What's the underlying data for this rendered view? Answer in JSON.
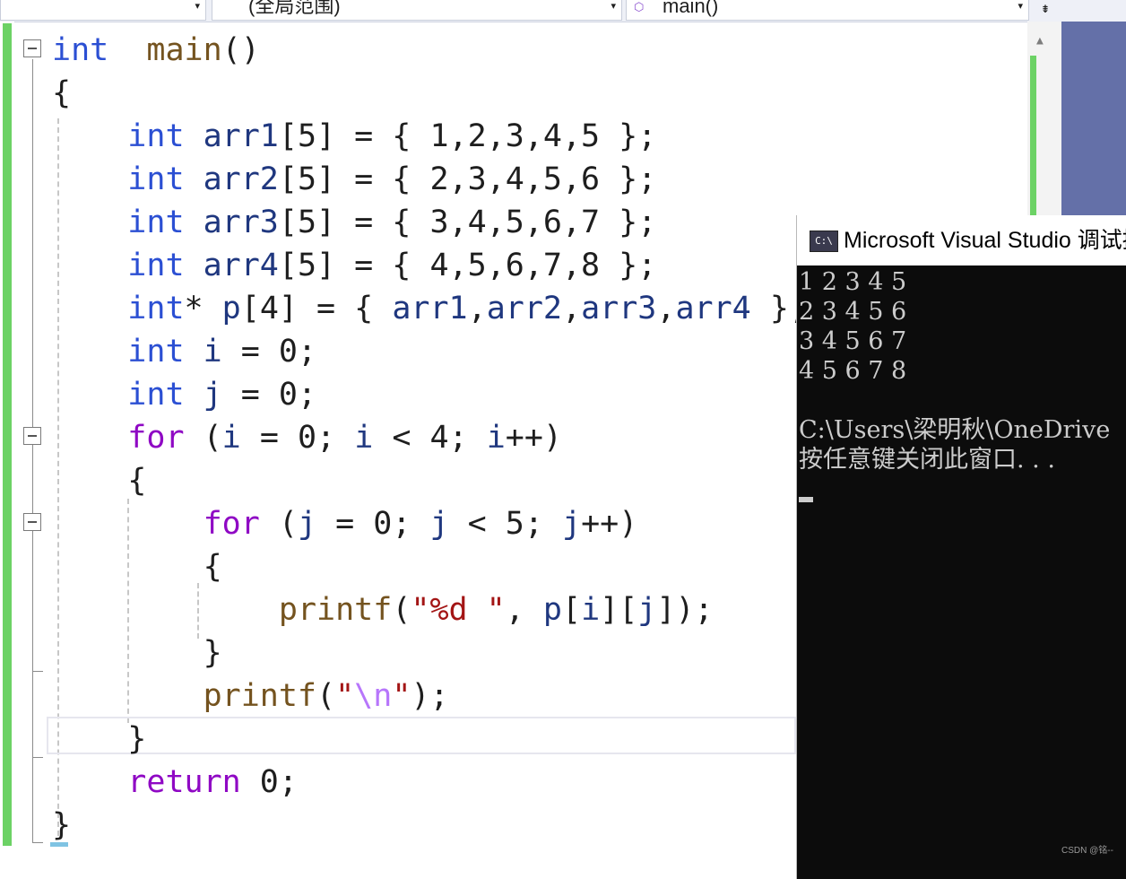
{
  "navbar": {
    "scope_combo": "(全局范围)",
    "function_combo": "main()",
    "dropdown_arrow": "▾",
    "split_button": "⇟"
  },
  "editor": {
    "lines": [
      [
        [
          "kw",
          "int"
        ],
        [
          "",
          "  "
        ],
        [
          "fn",
          "main"
        ],
        [
          "",
          "()"
        ]
      ],
      [
        [
          "",
          "{"
        ]
      ],
      [
        [
          "",
          "    "
        ],
        [
          "kw",
          "int"
        ],
        [
          "id",
          " arr1"
        ],
        [
          "",
          "[5] = { 1,2,3,4,5 };"
        ]
      ],
      [
        [
          "",
          "    "
        ],
        [
          "kw",
          "int"
        ],
        [
          "id",
          " arr2"
        ],
        [
          "",
          "[5] = { 2,3,4,5,6 };"
        ]
      ],
      [
        [
          "",
          "    "
        ],
        [
          "kw",
          "int"
        ],
        [
          "id",
          " arr3"
        ],
        [
          "",
          "[5] = { 3,4,5,6,7 };"
        ]
      ],
      [
        [
          "",
          "    "
        ],
        [
          "kw",
          "int"
        ],
        [
          "id",
          " arr4"
        ],
        [
          "",
          "[5] = { 4,5,6,7,8 };"
        ]
      ],
      [
        [
          "",
          "    "
        ],
        [
          "kw",
          "int"
        ],
        [
          "",
          "* "
        ],
        [
          "id",
          "p"
        ],
        [
          "",
          "[4] = { "
        ],
        [
          "id",
          "arr1"
        ],
        [
          "",
          ","
        ],
        [
          "id",
          "arr2"
        ],
        [
          "",
          ","
        ],
        [
          "id",
          "arr3"
        ],
        [
          "",
          ","
        ],
        [
          "id",
          "arr4"
        ],
        [
          "",
          " };"
        ]
      ],
      [
        [
          "",
          "    "
        ],
        [
          "kw",
          "int"
        ],
        [
          "id",
          " i"
        ],
        [
          "",
          " = 0;"
        ]
      ],
      [
        [
          "",
          "    "
        ],
        [
          "kw",
          "int"
        ],
        [
          "id",
          " j"
        ],
        [
          "",
          " = 0;"
        ]
      ],
      [
        [
          "",
          "    "
        ],
        [
          "ctl",
          "for"
        ],
        [
          "",
          " ("
        ],
        [
          "id",
          "i"
        ],
        [
          "",
          " = 0; "
        ],
        [
          "id",
          "i"
        ],
        [
          "",
          " < 4; "
        ],
        [
          "id",
          "i"
        ],
        [
          "",
          "++)"
        ]
      ],
      [
        [
          "",
          "    {"
        ]
      ],
      [
        [
          "",
          "        "
        ],
        [
          "ctl",
          "for"
        ],
        [
          "",
          " ("
        ],
        [
          "id",
          "j"
        ],
        [
          "",
          " = 0; "
        ],
        [
          "id",
          "j"
        ],
        [
          "",
          " < 5; "
        ],
        [
          "id",
          "j"
        ],
        [
          "",
          "++)"
        ]
      ],
      [
        [
          "",
          "        {"
        ]
      ],
      [
        [
          "",
          "            "
        ],
        [
          "fn",
          "printf"
        ],
        [
          "",
          "("
        ],
        [
          "str",
          "\"%d \""
        ],
        [
          "",
          ", "
        ],
        [
          "id",
          "p"
        ],
        [
          "",
          "["
        ],
        [
          "id",
          "i"
        ],
        [
          "",
          "]["
        ],
        [
          "id",
          "j"
        ],
        [
          "",
          "]);"
        ]
      ],
      [
        [
          "",
          "        }"
        ]
      ],
      [
        [
          "",
          "        "
        ],
        [
          "fn",
          "printf"
        ],
        [
          "",
          "("
        ],
        [
          "str",
          "\""
        ],
        [
          "esc",
          "\\n"
        ],
        [
          "str",
          "\""
        ],
        [
          "",
          ");"
        ]
      ],
      [
        [
          "",
          "    }"
        ]
      ],
      [
        [
          "",
          "    "
        ],
        [
          "ctl",
          "return"
        ],
        [
          "",
          " 0;"
        ]
      ],
      [
        [
          "",
          "}"
        ]
      ]
    ]
  },
  "console": {
    "title": "Microsoft Visual Studio 调试控制台",
    "icon_text": "C:\\",
    "output": [
      "1 2 3 4 5",
      "2 3 4 5 6",
      "3 4 5 6 7",
      "4 5 6 7 8",
      "",
      "C:\\Users\\梁明秋\\OneDrive",
      "按任意键关闭此窗口. . ."
    ]
  },
  "scrollbar": {
    "up_arrow": "▲"
  },
  "watermark": "CSDN @铭--",
  "colors": {
    "keyword": "#2b4fd3",
    "control": "#8f08c4",
    "function": "#74531f",
    "identifier": "#1f377f",
    "string": "#a31515",
    "escape": "#b776fb",
    "change_bar": "#6cd265",
    "console_bg": "#0c0c0c"
  }
}
